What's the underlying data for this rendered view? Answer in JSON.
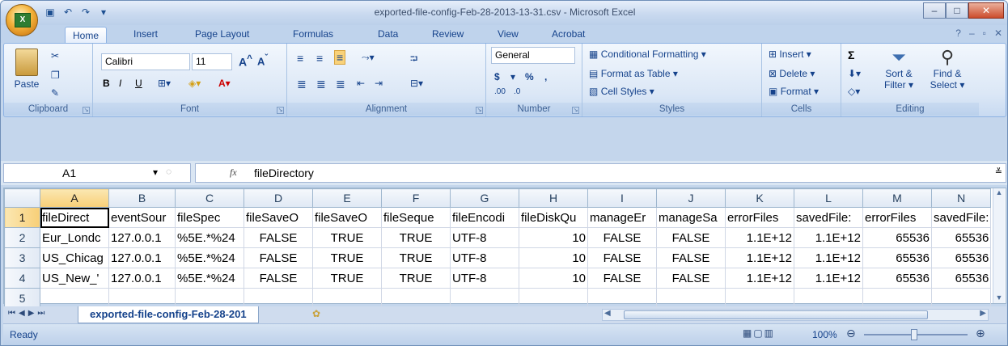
{
  "window": {
    "title": "exported-file-config-Feb-28-2013-13-31.csv - Microsoft Excel",
    "qat_icons": [
      "save-icon",
      "undo-icon",
      "redo-icon"
    ]
  },
  "tabs": [
    "Home",
    "Insert",
    "Page Layout",
    "Formulas",
    "Data",
    "Review",
    "View",
    "Acrobat"
  ],
  "active_tab": "Home",
  "ribbon": {
    "clipboard": {
      "label": "Clipboard",
      "paste": "Paste"
    },
    "font": {
      "label": "Font",
      "name": "Calibri",
      "size": "11",
      "bold": "B",
      "italic": "I",
      "underline": "U"
    },
    "alignment": {
      "label": "Alignment"
    },
    "number": {
      "label": "Number",
      "format": "General",
      "currency": "$",
      "percent": "%",
      "comma": ",",
      "inc": ".00",
      "dec": ".0"
    },
    "styles": {
      "label": "Styles",
      "conditional": "Conditional Formatting",
      "table": "Format as Table",
      "cell": "Cell Styles"
    },
    "cells": {
      "label": "Cells",
      "insert": "Insert",
      "delete": "Delete",
      "format": "Format"
    },
    "editing": {
      "label": "Editing",
      "sigma": "Σ",
      "sort": "Sort &",
      "sort2": "Filter",
      "find": "Find &",
      "find2": "Select"
    }
  },
  "formula_bar": {
    "name_box": "A1",
    "fx": "fx",
    "content": "fileDirectory"
  },
  "columns": [
    "A",
    "B",
    "C",
    "D",
    "E",
    "F",
    "G",
    "H",
    "I",
    "J",
    "K",
    "L",
    "M",
    "N"
  ],
  "rows": [
    {
      "n": "1",
      "cells": [
        "fileDirect",
        "eventSour",
        "fileSpec",
        "fileSaveO",
        "fileSaveO",
        "fileSeque",
        "fileEncodi",
        "fileDiskQu",
        "manageEr",
        "manageSa",
        "errorFiles",
        "savedFile:",
        "errorFiles",
        "savedFile:"
      ]
    },
    {
      "n": "2",
      "cells": [
        "Eur_Londc",
        "127.0.0.1",
        "%5E.*%24",
        "FALSE",
        "TRUE",
        "TRUE",
        "UTF-8",
        "10",
        "FALSE",
        "FALSE",
        "1.1E+12",
        "1.1E+12",
        "65536",
        "65536"
      ]
    },
    {
      "n": "3",
      "cells": [
        "US_Chicag",
        "127.0.0.1",
        "%5E.*%24",
        "FALSE",
        "TRUE",
        "TRUE",
        "UTF-8",
        "10",
        "FALSE",
        "FALSE",
        "1.1E+12",
        "1.1E+12",
        "65536",
        "65536"
      ]
    },
    {
      "n": "4",
      "cells": [
        "US_New_'",
        "127.0.0.1",
        "%5E.*%24",
        "FALSE",
        "TRUE",
        "TRUE",
        "UTF-8",
        "10",
        "FALSE",
        "FALSE",
        "1.1E+12",
        "1.1E+12",
        "65536",
        "65536"
      ]
    },
    {
      "n": "5",
      "cells": [
        "",
        "",
        "",
        "",
        "",
        "",
        "",
        "",
        "",
        "",
        "",
        "",
        "",
        ""
      ]
    }
  ],
  "sheet_tab": "exported-file-config-Feb-28-201",
  "status": {
    "text": "Ready",
    "zoom": "100%"
  }
}
